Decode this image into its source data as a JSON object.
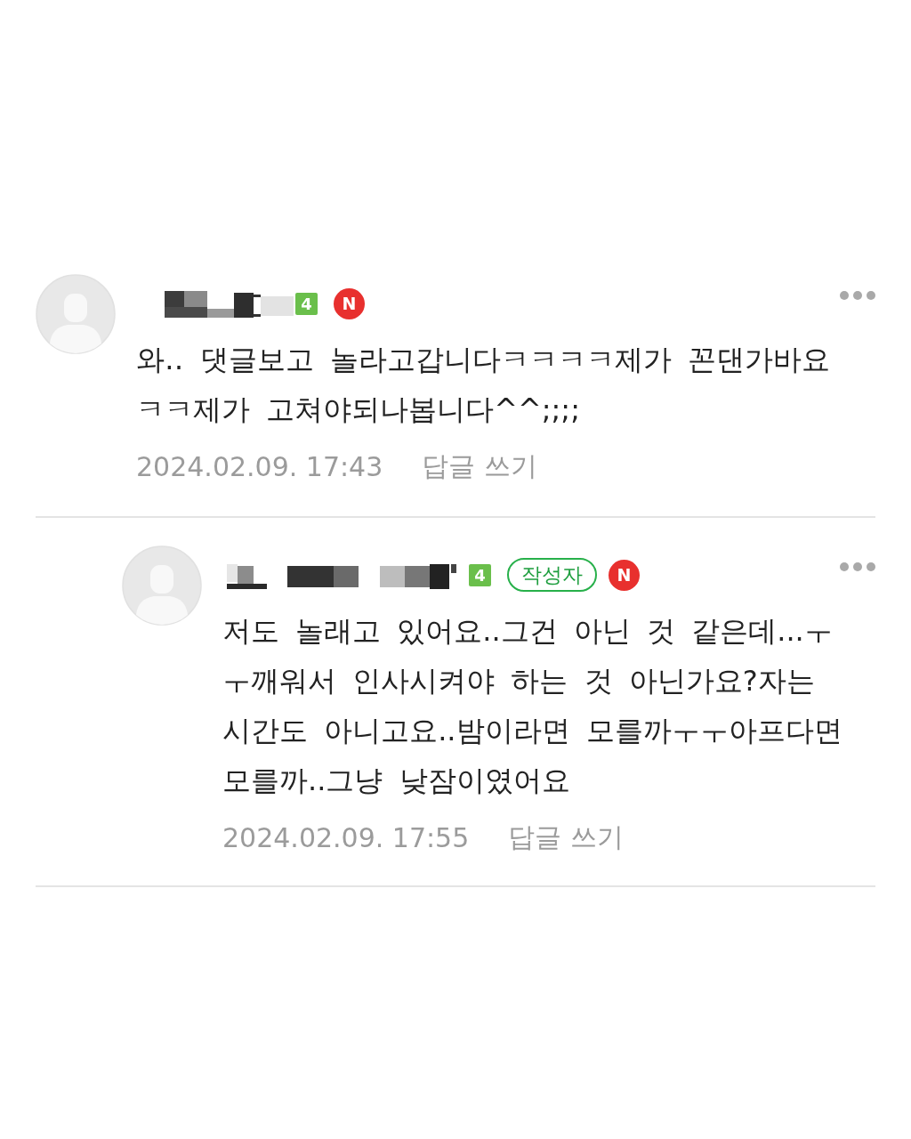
{
  "comments": [
    {
      "level_badge": "4",
      "new_badge": "N",
      "text": "와‥ 댓글보고 놀라고갑니다ㅋㅋㅋㅋ제가 꼰댄가바요ㅋㅋ제가 고쳐야되나봅니다^^;;;;",
      "date": "2024.02.09. 17:43",
      "reply_link": "답글 쓰기",
      "children": [
        {
          "level_badge": "4",
          "author_badge": "작성자",
          "new_badge": "N",
          "text": "저도 놀래고 있어요..그건 아닌 것 같은데...ㅜㅜ깨워서 인사시켜야 하는 것 아닌가요?자는 시간도 아니고요..밤이라면 모를까ㅜㅜ아프다면 모를까..그냥 낮잠이였어요",
          "date": "2024.02.09. 17:55",
          "reply_link": "답글 쓰기"
        }
      ]
    }
  ]
}
